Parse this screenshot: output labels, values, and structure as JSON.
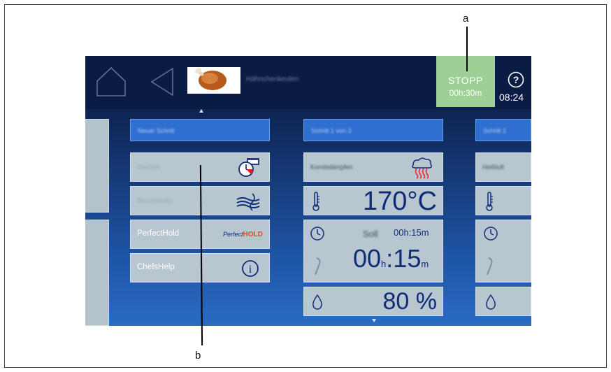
{
  "callouts": {
    "a": "a",
    "b": "b"
  },
  "topbar": {
    "dish_name": "Hähnchenkeulen",
    "stopp_label": "STOPP",
    "stopp_time": "00h:30m",
    "help_symbol": "?",
    "clock": "08:24",
    "stopp_color": "#9ed095"
  },
  "columns": [
    {
      "header": "Neuer Schritt"
    },
    {
      "header": "Schritt 1 von 3"
    },
    {
      "header": "Schritt 2"
    }
  ],
  "functions": [
    {
      "label": "Startzeit",
      "icon": "timer-calendar-icon"
    },
    {
      "label": "Beschwaden",
      "icon": "steam-wave-icon"
    },
    {
      "label": "PerfectHold",
      "icon": "perfecthold-logo",
      "logo_a": "Perfect",
      "logo_b": "HOLD"
    },
    {
      "label": "ChefsHelp",
      "icon": "info-icon",
      "icon_symbol": "i"
    }
  ],
  "step1": {
    "mode_label": "Kombidämpfen",
    "mode_icon": "combi-steam-icon",
    "temperature": "170°C",
    "time_prefix": "Soll",
    "time_set": "00h:15m",
    "time_hours": "00",
    "time_h_unit": "h",
    "time_sep": ":",
    "time_minutes": "15",
    "time_m_unit": "m",
    "humidity": "80 %"
  },
  "step2": {
    "mode_label": "Heißluft"
  }
}
